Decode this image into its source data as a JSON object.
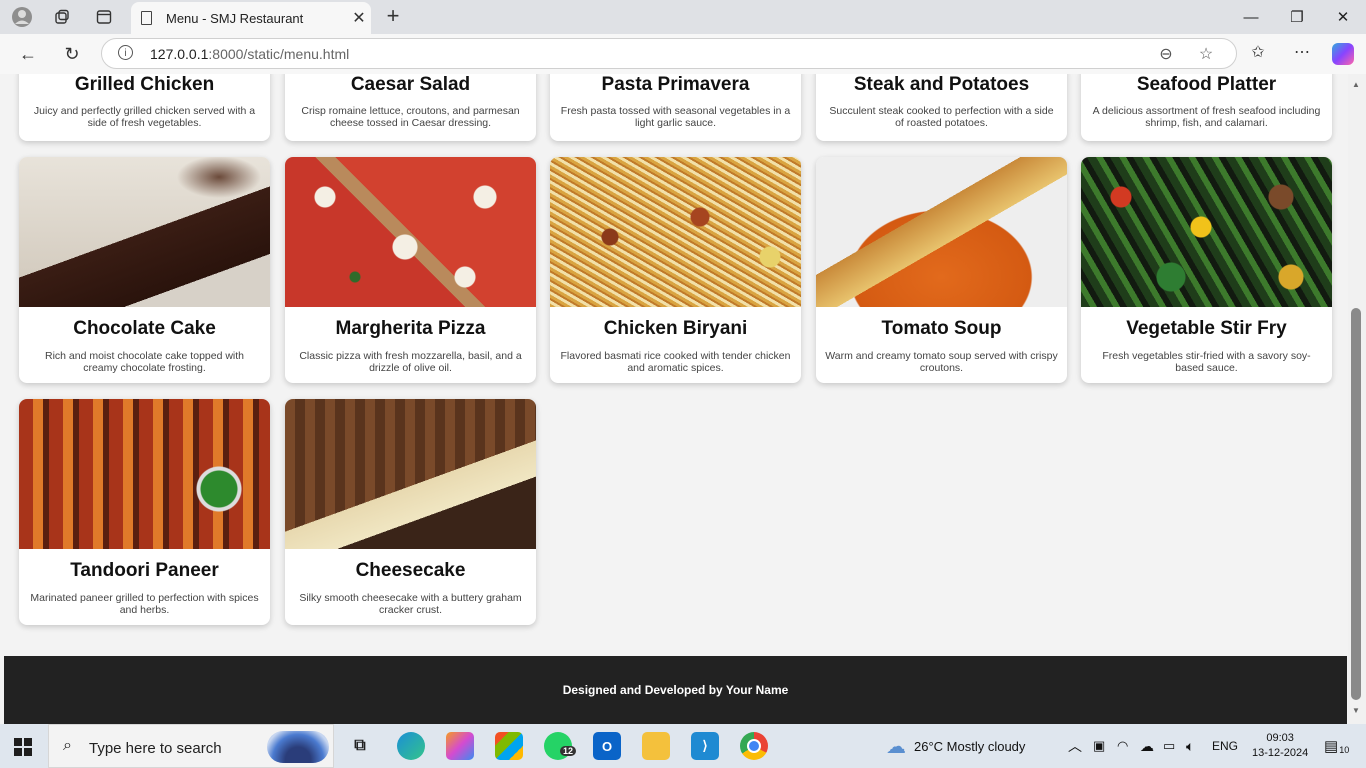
{
  "browser": {
    "tab_title": "Menu - SMJ Restaurant",
    "url_host": "127.0.0.1",
    "url_rest": ":8000/static/menu.html"
  },
  "menu": {
    "top_row": [
      {
        "name": "Grilled Chicken",
        "desc": "Juicy and perfectly grilled chicken served with a side of fresh vegetables."
      },
      {
        "name": "Caesar Salad",
        "desc": "Crisp romaine lettuce, croutons, and parmesan cheese tossed in Caesar dressing."
      },
      {
        "name": "Pasta Primavera",
        "desc": "Fresh pasta tossed with seasonal vegetables in a light garlic sauce."
      },
      {
        "name": "Steak and Potatoes",
        "desc": "Succulent steak cooked to perfection with a side of roasted potatoes."
      },
      {
        "name": "Seafood Platter",
        "desc": "A delicious assortment of fresh seafood including shrimp, fish, and calamari."
      }
    ],
    "items": [
      {
        "name": "Chocolate Cake",
        "desc": "Rich and moist chocolate cake topped with creamy chocolate frosting.",
        "image": "chocolate-cake-image"
      },
      {
        "name": "Margherita Pizza",
        "desc": "Classic pizza with fresh mozzarella, basil, and a drizzle of olive oil.",
        "image": "margherita-pizza-image"
      },
      {
        "name": "Chicken Biryani",
        "desc": "Flavored basmati rice cooked with tender chicken and aromatic spices.",
        "image": "chicken-biryani-image"
      },
      {
        "name": "Tomato Soup",
        "desc": "Warm and creamy tomato soup served with crispy croutons.",
        "image": "tomato-soup-image"
      },
      {
        "name": "Vegetable Stir Fry",
        "desc": "Fresh vegetables stir-fried with a savory soy-based sauce.",
        "image": "vegetable-stir-fry-image"
      },
      {
        "name": "Tandoori Paneer",
        "desc": "Marinated paneer grilled to perfection with spices and herbs.",
        "image": "tandoori-paneer-image"
      },
      {
        "name": "Cheesecake",
        "desc": "Silky smooth cheesecake with a buttery graham cracker crust.",
        "image": "cheesecake-image"
      }
    ]
  },
  "footer": {
    "text": "Designed and Developed by Your Name"
  },
  "taskbar": {
    "search_placeholder": "Type here to search",
    "whatsapp_badge": "12",
    "weather": "26°C  Mostly cloudy",
    "lang": "ENG",
    "time": "09:03",
    "date": "13-12-2024",
    "notif_count": "10"
  }
}
